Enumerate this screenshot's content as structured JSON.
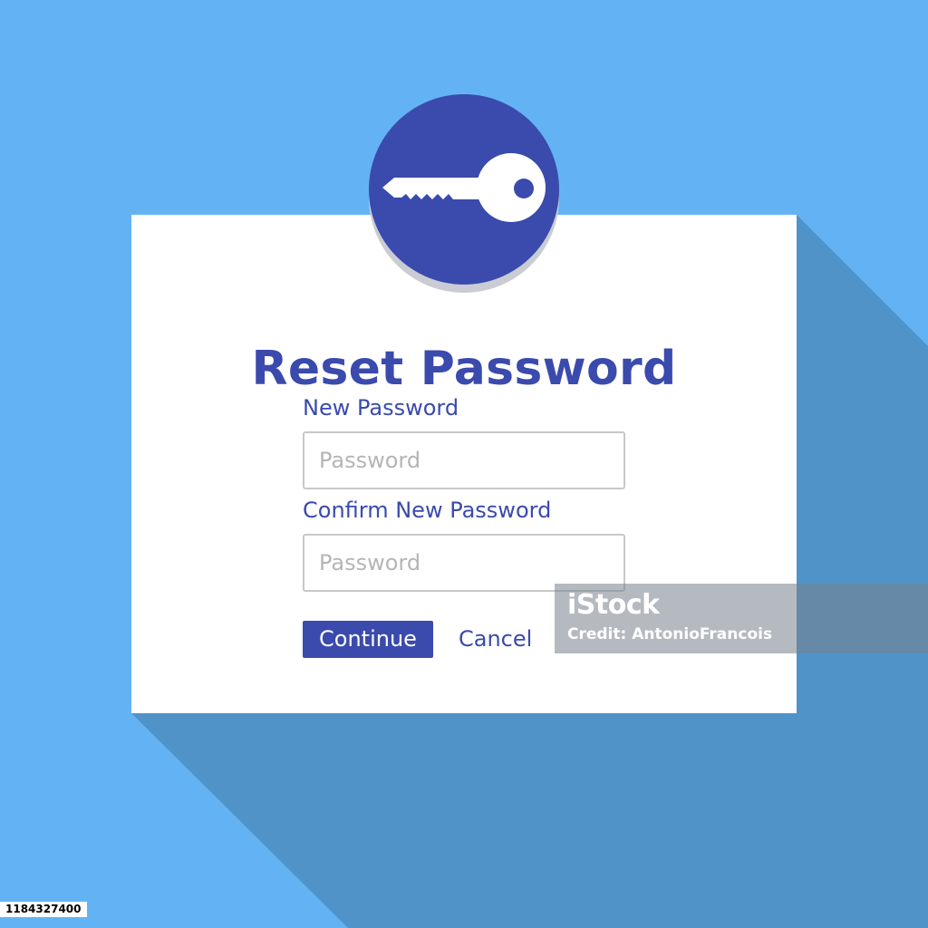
{
  "colors": {
    "background": "#63b3f4",
    "long_shadow": "#5093c8",
    "accent": "#3a4aad",
    "card": "#ffffff",
    "input_border": "#c8c8c8",
    "placeholder": "#b5b5b5"
  },
  "icon": {
    "name": "key-icon"
  },
  "form": {
    "title": "Reset Password",
    "new_password": {
      "label": "New Password",
      "placeholder": "Password",
      "value": ""
    },
    "confirm_password": {
      "label": "Confirm New Password",
      "placeholder": "Password",
      "value": ""
    },
    "continue_label": "Continue",
    "cancel_label": "Cancel"
  },
  "watermark": {
    "brand": "iStock",
    "credit": "Credit: AntonioFrancois",
    "image_id": "1184327400"
  }
}
